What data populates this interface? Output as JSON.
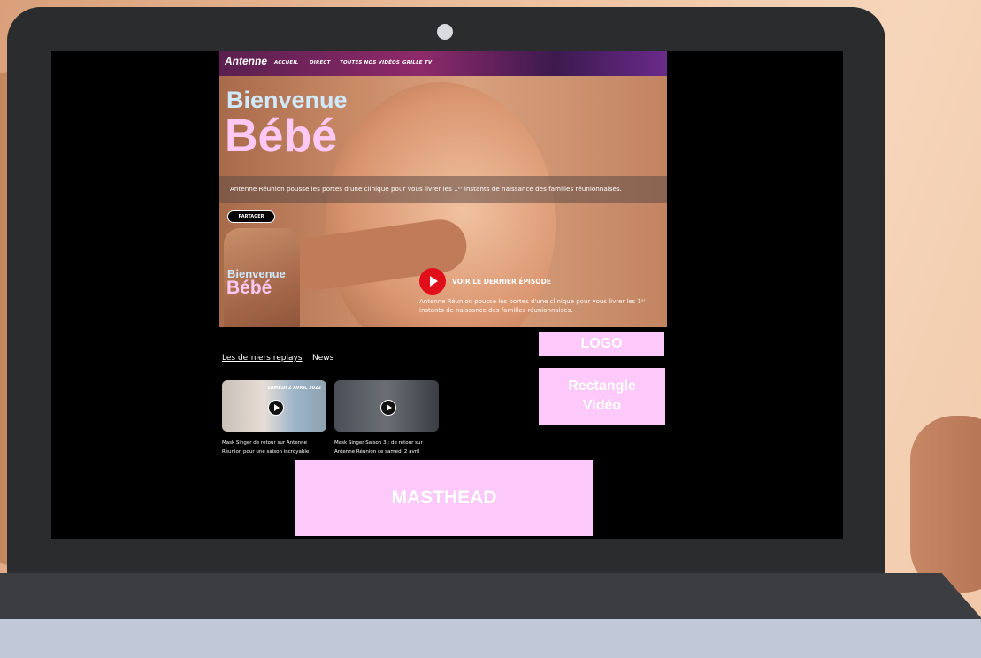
{
  "site": {
    "logo": "Antenne",
    "nav": [
      "ACCUEIL",
      "DIRECT",
      "TOUTES NOS VIDÉOS",
      "GRILLE TV"
    ],
    "hero_title_line1": "Bienvenue",
    "hero_title_line2": "Bébé",
    "hero_caption": "Antenne Réunion pousse les portes d'une clinique pour vous livrer les 1ᵉʳ instants de naissance des familles réunionnaises.",
    "share_label": "PARTAGER",
    "poster_line1": "Bienvenue",
    "poster_line2": "Bébé",
    "last_episode_label": "VOIR LE DERNIER ÉPISODE",
    "episode_description": "Antenne Réunion pousse les portes d'une clinique pour vous livrer les 1ᵉʳ instants de naissance des familles réunionnaises.",
    "tabs": [
      "Les derniers replays",
      "News"
    ],
    "videos": [
      {
        "title": "Mask Singer de retour sur Antenne Réunion pour une saison incroyable",
        "thumb_text": "SAMEDI 2 AVRIL 2022"
      },
      {
        "title": "Mask Singer Saison 3 : de retour sur Antenne Réunion ce samedi 2 avril",
        "thumb_text": ""
      }
    ]
  },
  "ads": {
    "logo": "LOGO",
    "rectangle_line1": "Rectangle",
    "rectangle_line2": "Vidéo",
    "masthead": "MASTHEAD"
  },
  "colors": {
    "ad_pink": "#fdc9fa",
    "play_red": "#e10f1a",
    "title_blue": "#cfe9ff",
    "title_pink": "#ffc8f5"
  }
}
